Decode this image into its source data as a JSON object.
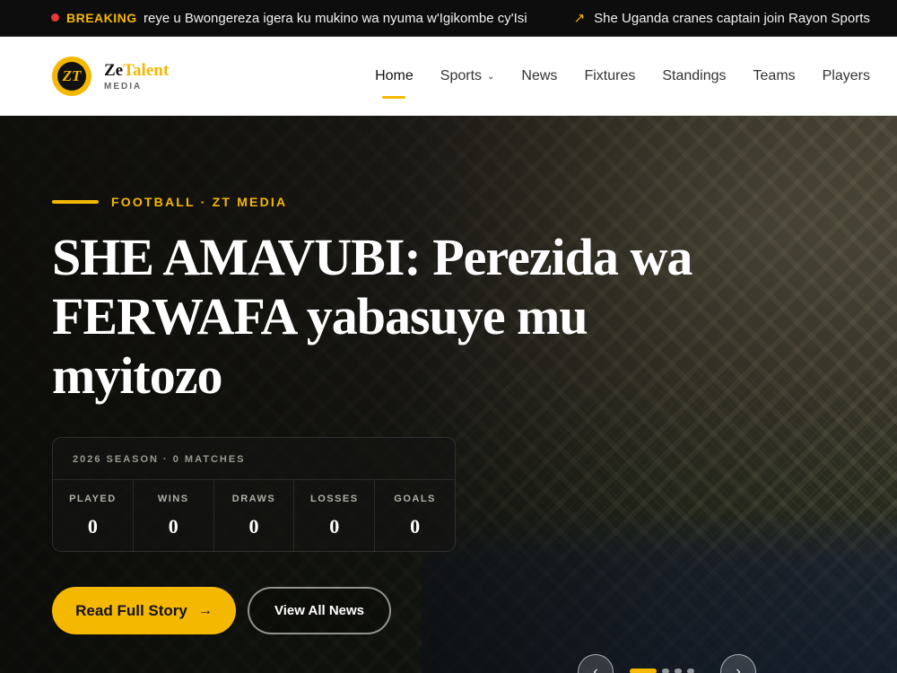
{
  "ticker": {
    "breaking_label": "BREAKING",
    "items": [
      "reye u Bwongereza igera ku mukino wa nyuma w'Igikombe cy'Isi",
      "She Uganda cranes captain join Rayon Sports"
    ],
    "trend_icon": "trending-up-icon"
  },
  "brand": {
    "mark_text": "ZT",
    "name_part1": "Ze",
    "name_part2": "Talent",
    "sub": "MEDIA",
    "accent": "#f5b800"
  },
  "nav": {
    "items": [
      "Home",
      "Sports",
      "News",
      "Fixtures",
      "Standings",
      "Teams",
      "Players"
    ],
    "active": "Home"
  },
  "hero": {
    "kicker": "FOOTBALL · ZT MEDIA",
    "headline": "SHE AMAVUBI: Perezida wa FERWAFA yabasuye mu myitozo",
    "stats": {
      "heading": "2026 SEASON · 0 MATCHES",
      "cells": [
        {
          "label": "PLAYED",
          "value": "0"
        },
        {
          "label": "WINS",
          "value": "0"
        },
        {
          "label": "DRAWS",
          "value": "0"
        },
        {
          "label": "LOSSES",
          "value": "0"
        },
        {
          "label": "GOALS",
          "value": "0"
        }
      ]
    },
    "primary_button": "Read Full Story",
    "secondary_button": "View All News"
  }
}
